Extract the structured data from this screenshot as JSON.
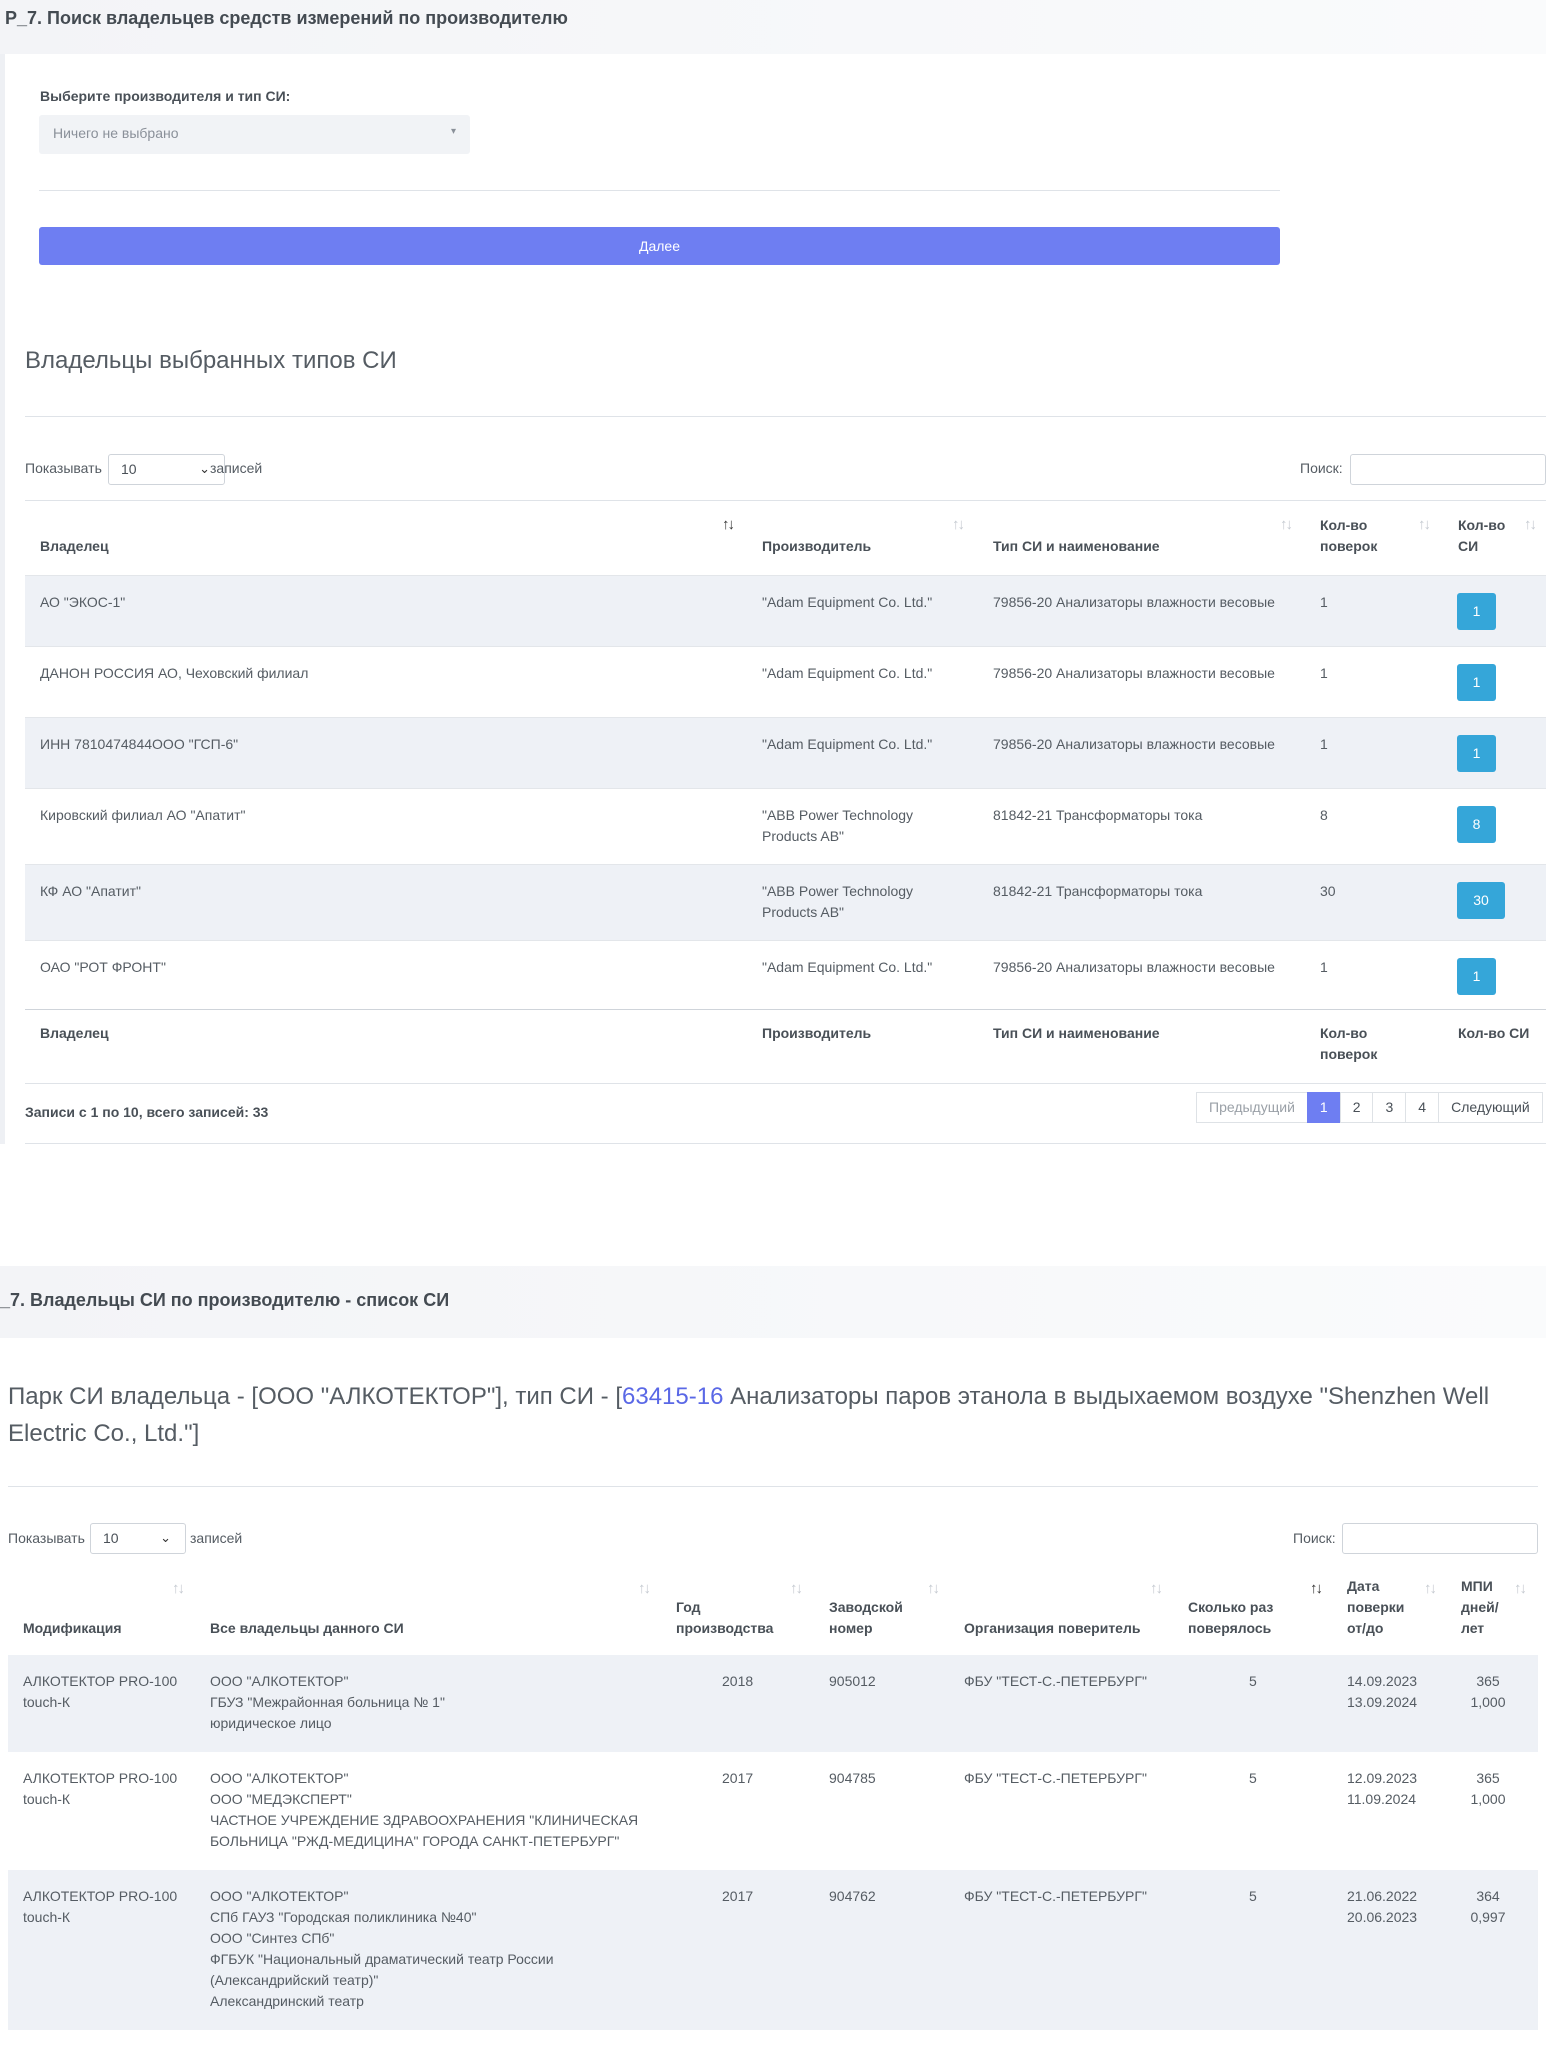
{
  "section1": {
    "header": "P_7. Поиск владельцев средств измерений по производителю",
    "select_label": "Выберите производителя и тип СИ:",
    "select_value": "Ничего не выбрано",
    "next_button": "Далее",
    "table_title": "Владельцы выбранных типов СИ",
    "show_label": "Показывать",
    "entries_label": "записей",
    "page_length": "10",
    "search_label": "Поиск:",
    "columns": [
      "Владелец",
      "Производитель",
      "Тип СИ и наименование",
      "Кол-во поверок",
      "Кол-во СИ"
    ],
    "rows": [
      {
        "owner": "АО \"ЭКОС-1\"",
        "maker": "\"Adam Equipment Co. Ltd.\"",
        "type": "79856-20 Анализаторы влажности весовые",
        "checks": "1",
        "count": "1"
      },
      {
        "owner": "ДАНОН РОССИЯ АО, Чеховский филиал",
        "maker": "\"Adam Equipment Co. Ltd.\"",
        "type": "79856-20 Анализаторы влажности весовые",
        "checks": "1",
        "count": "1"
      },
      {
        "owner": "ИНН 7810474844ООО \"ГСП-6\"",
        "maker": "\"Adam Equipment Co. Ltd.\"",
        "type": "79856-20 Анализаторы влажности весовые",
        "checks": "1",
        "count": "1"
      },
      {
        "owner": "Кировский филиал АО \"Апатит\"",
        "maker": "\"ABB Power Technology Products AB\"",
        "type": "81842-21 Трансформаторы тока",
        "checks": "8",
        "count": "8"
      },
      {
        "owner": "КФ АО \"Апатит\"",
        "maker": "\"ABB Power Technology Products AB\"",
        "type": "81842-21 Трансформаторы тока",
        "checks": "30",
        "count": "30"
      },
      {
        "owner": "ОАО \"РОТ ФРОНТ\"",
        "maker": "\"Adam Equipment Co. Ltd.\"",
        "type": "79856-20 Анализаторы влажности весовые",
        "checks": "1",
        "count": "1"
      }
    ],
    "footer_columns": [
      "Владелец",
      "Производитель",
      "Тип СИ и наименование",
      "Кол-во поверок",
      "Кол-во СИ"
    ],
    "info": "Записи с 1 по 10, всего записей: 33",
    "pagination": {
      "prev": "Предыдущий",
      "pages": [
        "1",
        "2",
        "3",
        "4"
      ],
      "next": "Следующий",
      "active": "1"
    }
  },
  "section2": {
    "header": "_7. Владельцы СИ по производителю - список СИ",
    "title_prefix": "Парк СИ владельца - [ООО \"АЛКОТЕКТОР\"], тип СИ - [",
    "title_link": "63415-16",
    "title_suffix": " Анализаторы паров этанола в выдыхаемом воздухе \"Shenzhen Well Electric Co., Ltd.\"]",
    "show_label": "Показывать",
    "entries_label": "записей",
    "page_length": "10",
    "search_label": "Поиск:",
    "columns": [
      "Модификация",
      "Все владельцы данного СИ",
      "Год производства",
      "Заводской номер",
      "Организация поверитель",
      "Сколько раз поверялось",
      "Дата поверки от/до",
      "МПИ дней/ лет"
    ],
    "rows": [
      {
        "mod": "АЛКОТЕКТОР PRO-100 touch-К",
        "owners": [
          "ООО \"АЛКОТЕКТОР\"",
          "ГБУЗ \"Межрайонная больница № 1\"",
          "юридическое лицо"
        ],
        "year": "2018",
        "serial": "905012",
        "org": "ФБУ \"ТЕСТ-С.-ПЕТЕРБУРГ\"",
        "times": "5",
        "date_from": "14.09.2023",
        "date_to": "13.09.2024",
        "mpi_days": "365",
        "mpi_years": "1,000"
      },
      {
        "mod": "АЛКОТЕКТОР PRO-100 touch-К",
        "owners": [
          "ООО \"АЛКОТЕКТОР\"",
          "ООО \"МЕДЭКСПЕРТ\"",
          "ЧАСТНОЕ УЧРЕЖДЕНИЕ ЗДРАВООХРАНЕНИЯ \"КЛИНИЧЕСКАЯ",
          "БОЛЬНИЦА \"РЖД-МЕДИЦИНА\" ГОРОДА САНКТ-ПЕТЕРБУРГ\""
        ],
        "year": "2017",
        "serial": "904785",
        "org": "ФБУ \"ТЕСТ-С.-ПЕТЕРБУРГ\"",
        "times": "5",
        "date_from": "12.09.2023",
        "date_to": "11.09.2024",
        "mpi_days": "365",
        "mpi_years": "1,000"
      },
      {
        "mod": "АЛКОТЕКТОР PRO-100 touch-К",
        "owners": [
          "ООО \"АЛКОТЕКТОР\"",
          "СПб ГАУЗ \"Городская поликлиника №40\"",
          "ООО \"Синтез СПб\"",
          "ФГБУК \"Национальный драматический театр России",
          "(Александрийский театр)\"",
          "Александринский театр"
        ],
        "year": "2017",
        "serial": "904762",
        "org": "ФБУ \"ТЕСТ-С.-ПЕТЕРБУРГ\"",
        "times": "5",
        "date_from": "21.06.2022",
        "date_to": "20.06.2023",
        "mpi_days": "364",
        "mpi_years": "0,997"
      }
    ]
  }
}
